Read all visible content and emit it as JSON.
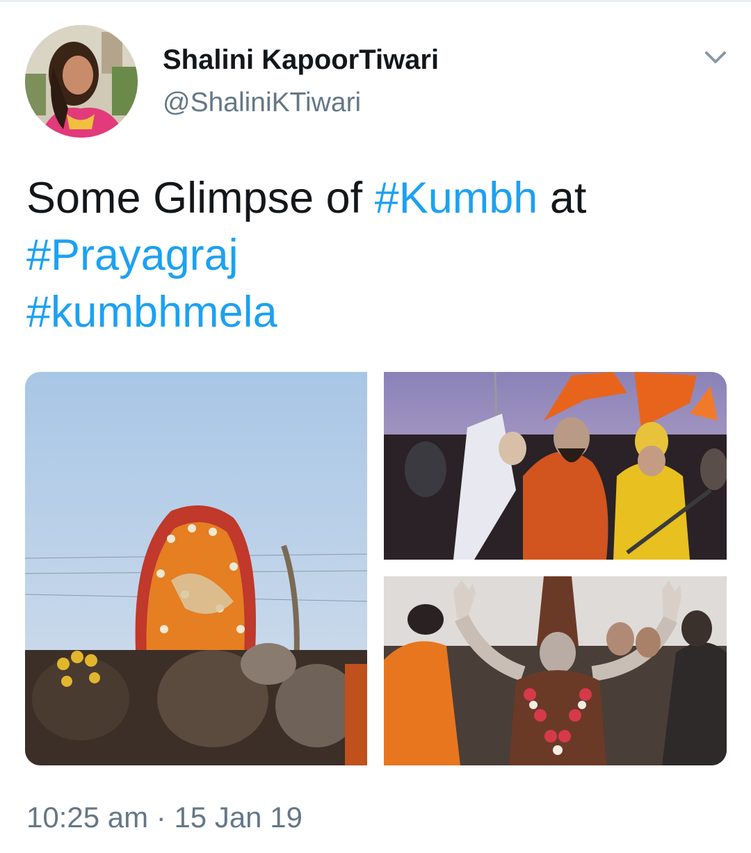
{
  "tweet": {
    "author": {
      "display_name": "Shalini KapoorTiwari",
      "handle": "@ShaliniKTiwari",
      "avatar_icon": "profile-photo"
    },
    "text": {
      "line1_prefix": "Some Glimpse of ",
      "line1_tag": "#Kumbh",
      "line1_suffix": " at",
      "line2_tag": "#Prayagraj",
      "line3_tag": "#kumbhmela"
    },
    "media": [
      {
        "id": "photo-1",
        "subject": "Procession with marigold-decorated palanquin and ash-covered sadhus"
      },
      {
        "id": "photo-2",
        "subject": "Saffron-robed saints with orange flags"
      },
      {
        "id": "photo-3",
        "subject": "Sadhu with rudraksha headdress and garlands"
      }
    ],
    "timestamp": "10:25 am · 15 Jan 19",
    "menu_icon": "chevron-down-icon"
  },
  "colors": {
    "text": "#14171a",
    "secondary": "#657786",
    "link": "#1da1f2",
    "divider": "#e6ecf0"
  }
}
